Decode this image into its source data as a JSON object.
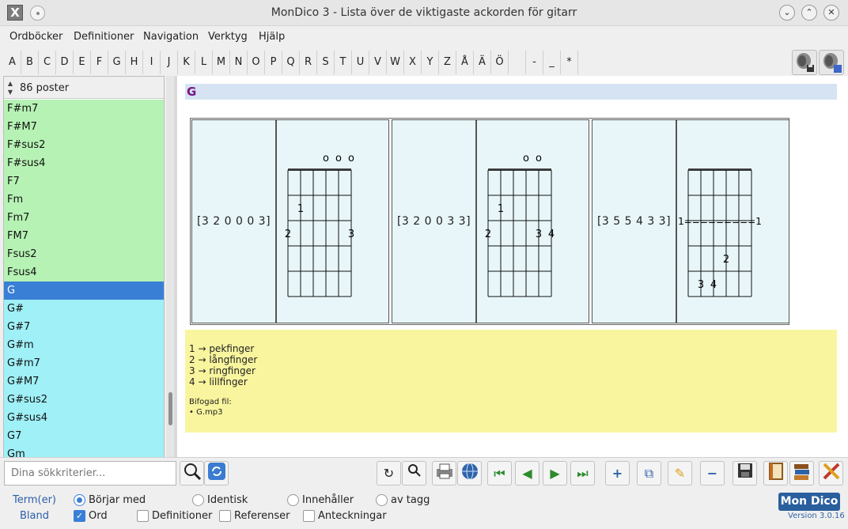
{
  "window": {
    "title": "MonDico 3 - Lista över de viktigaste ackorden för gitarr"
  },
  "menu": [
    "Ordböcker",
    "Definitioner",
    "Navigation",
    "Verktyg",
    "Hjälp"
  ],
  "alphabet": [
    "A",
    "B",
    "C",
    "D",
    "E",
    "F",
    "G",
    "H",
    "I",
    "J",
    "K",
    "L",
    "M",
    "N",
    "O",
    "P",
    "Q",
    "R",
    "S",
    "T",
    "U",
    "V",
    "W",
    "X",
    "Y",
    "Z",
    "Å",
    "Ä",
    "Ö",
    "",
    "-",
    "_",
    "*"
  ],
  "list": {
    "count": "86 poster",
    "items": [
      {
        "label": "F#m7",
        "style": "green"
      },
      {
        "label": "F#M7",
        "style": "green"
      },
      {
        "label": "F#sus2",
        "style": "green"
      },
      {
        "label": "F#sus4",
        "style": "green"
      },
      {
        "label": "F7",
        "style": "green"
      },
      {
        "label": "Fm",
        "style": "green"
      },
      {
        "label": "Fm7",
        "style": "green"
      },
      {
        "label": "FM7",
        "style": "green"
      },
      {
        "label": "Fsus2",
        "style": "green"
      },
      {
        "label": "Fsus4",
        "style": "green"
      },
      {
        "label": "G",
        "style": "sel"
      },
      {
        "label": "G#",
        "style": "cyan"
      },
      {
        "label": "G#7",
        "style": "cyan"
      },
      {
        "label": "G#m",
        "style": "cyan"
      },
      {
        "label": "G#m7",
        "style": "cyan"
      },
      {
        "label": "G#M7",
        "style": "cyan"
      },
      {
        "label": "G#sus2",
        "style": "cyan"
      },
      {
        "label": "G#sus4",
        "style": "cyan"
      },
      {
        "label": "G7",
        "style": "cyan"
      },
      {
        "label": "Gm",
        "style": "cyan"
      }
    ]
  },
  "entry": {
    "title": "G",
    "chords": [
      {
        "frets": "[3 2 0 0 0 3]",
        "open": [
          "",
          "",
          "",
          "o",
          "o",
          "o"
        ],
        "marks": [
          {
            "t": "1",
            "s": 1,
            "f": 2
          },
          {
            "t": "2",
            "s": 0,
            "f": 3
          },
          {
            "t": "3",
            "s": 5,
            "f": 3
          }
        ]
      },
      {
        "frets": "[3 2 0 0 3 3]",
        "open": [
          "",
          "",
          "",
          "o",
          "o",
          ""
        ],
        "marks": [
          {
            "t": "1",
            "s": 1,
            "f": 2
          },
          {
            "t": "2",
            "s": 0,
            "f": 3
          },
          {
            "t": "3",
            "s": 4,
            "f": 3
          },
          {
            "t": "4",
            "s": 5,
            "f": 3
          }
        ]
      },
      {
        "frets": "[3 5 5 4 3 3]",
        "open": [
          "",
          "",
          "",
          "",
          "",
          ""
        ],
        "barre": "1=========1",
        "marks": [
          {
            "t": "2",
            "s": 3,
            "f": 4
          },
          {
            "t": "3",
            "s": 1,
            "f": 5
          },
          {
            "t": "4",
            "s": 2,
            "f": 5
          }
        ]
      }
    ],
    "legend": [
      "1 → pekfinger",
      "2 → långfinger",
      "3 → ringfinger",
      "4 → lillfinger"
    ],
    "attachment_label": "Bifogad fil:",
    "attachment_file": "• G.mp3"
  },
  "search": {
    "placeholder": "Dina sökkriterier..."
  },
  "options": {
    "terms_label": "Term(er)",
    "mix_label": "Bland",
    "radios": [
      {
        "label": "Börjar med",
        "checked": true
      },
      {
        "label": "Identisk",
        "checked": false
      },
      {
        "label": "Innehåller",
        "checked": false
      },
      {
        "label": "av tagg",
        "checked": false
      }
    ],
    "checks": [
      {
        "label": "Ord",
        "checked": true
      },
      {
        "label": "Definitioner",
        "checked": false
      },
      {
        "label": "Referenser",
        "checked": false
      },
      {
        "label": "Anteckningar",
        "checked": false
      }
    ]
  },
  "branding": {
    "logo": "Mon Dico",
    "version": "Version 3.0.16"
  }
}
